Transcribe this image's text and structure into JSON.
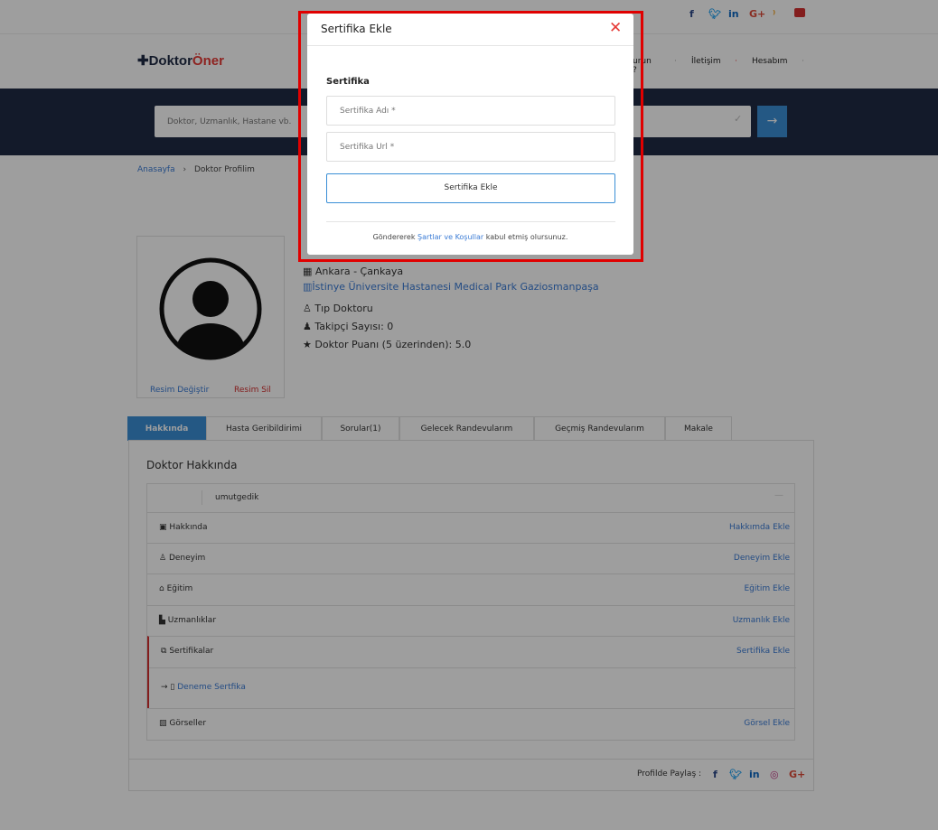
{
  "brand": {
    "logo_text_a": "Doktor",
    "logo_text_b": "Öner"
  },
  "nav": {
    "item1": "urun ?",
    "item2": "İletişim",
    "item3": "Hesabım"
  },
  "search": {
    "placeholder": "Doktor, Uzmanlık, Hastane vb."
  },
  "breadcrumb": {
    "home": "Anasayfa",
    "current": "Doktor Profilim"
  },
  "profile": {
    "change_photo": "Resim Değiştir",
    "delete_photo": "Resim Sil",
    "location": "Ankara - Çankaya",
    "hospital": "İstinye Üniversite Hastanesi Medical Park Gaziosmanpaşa",
    "title": "Tıp Doktoru",
    "followers": "Takipçi Sayısı: 0",
    "rating": "Doktor Puanı (5 üzerinden): 5.0"
  },
  "tabs": [
    {
      "label": "Hakkında"
    },
    {
      "label": "Hasta Geribildirimi"
    },
    {
      "label": "Sorular(1)"
    },
    {
      "label": "Gelecek Randevularım"
    },
    {
      "label": "Geçmiş Randevularım"
    },
    {
      "label": "Makale"
    }
  ],
  "about": {
    "heading": "Doktor Hakkında",
    "username": "umutgedik",
    "rows": [
      {
        "label": "Hakkında",
        "action": "Hakkımda Ekle"
      },
      {
        "label": "Deneyim",
        "action": "Deneyim Ekle"
      },
      {
        "label": "Eğitim",
        "action": "Eğitim Ekle"
      },
      {
        "label": "Uzmanlıklar",
        "action": "Uzmanlık Ekle"
      },
      {
        "label": "Sertifikalar",
        "action": "Sertifika Ekle"
      },
      {
        "label": "Görseller",
        "action": "Görsel Ekle"
      }
    ],
    "cert_item": "Deneme Sertfika"
  },
  "share": {
    "label": "Profilde Paylaş :"
  },
  "modal": {
    "title": "Sertifika Ekle",
    "section": "Sertifika",
    "name_placeholder": "Sertifika Adı *",
    "url_placeholder": "Sertifika Url *",
    "submit": "Sertifika Ekle",
    "terms_prefix": "Göndererek ",
    "terms_link": "Şartlar ve Koşullar",
    "terms_suffix": " kabul etmiş olursunuz."
  },
  "colors": {
    "accent": "#3a7bd5",
    "header_band": "#1f2a44",
    "highlight": "#e00000",
    "danger": "#d32f2f",
    "tab_active": "#3a8fd6"
  }
}
